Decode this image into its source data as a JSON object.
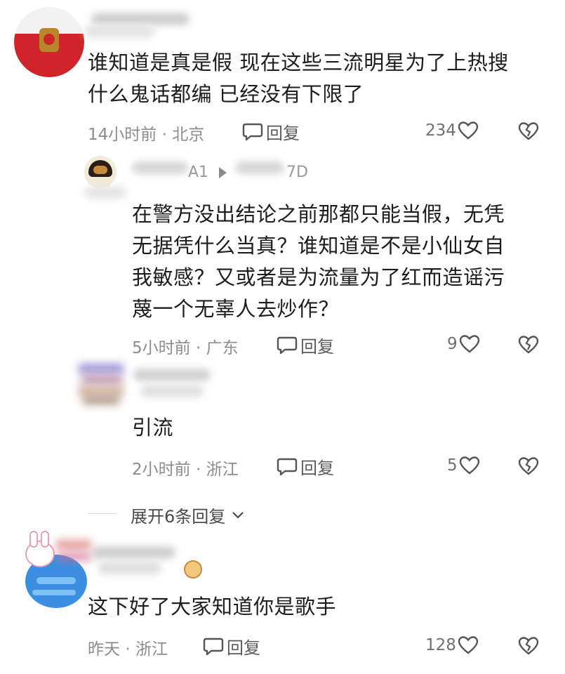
{
  "comments": [
    {
      "text_lines": [
        "谁知道是真是假 现在这些三流明星为了上热搜",
        "什么鬼话都编 已经没有下限了"
      ],
      "time": "14小时前",
      "location": "北京",
      "reply_label": "回复",
      "likes": "234"
    },
    {
      "author_visible": "A1",
      "reply_to_visible": "7D",
      "text_lines": [
        "在警方没出结论之前那都只能当假，无凭",
        "无据凭什么当真？谁知道是不是小仙女自",
        "我敏感？又或者是为流量为了红而造谣污",
        "蔑一个无辜人去炒作？"
      ],
      "time": "5小时前",
      "location": "广东",
      "reply_label": "回复",
      "likes": "9"
    },
    {
      "text_lines": [
        "引流"
      ],
      "time": "2小时前",
      "location": "浙江",
      "reply_label": "回复",
      "likes": "5"
    },
    {
      "text_lines": [
        "这下好了大家知道你是歌手"
      ],
      "time": "昨天",
      "location": "浙江",
      "reply_label": "回复",
      "likes": "128"
    }
  ],
  "expand_replies": "展开6条回复",
  "meta_separator": "·",
  "colors": {
    "text": "#1d1d1d",
    "meta": "#8c8c8c",
    "icon": "#555555"
  }
}
